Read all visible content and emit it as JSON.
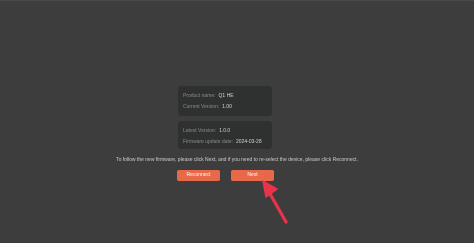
{
  "device": {
    "product_name_label": "Product name:",
    "product_name_value": "Q1 HE",
    "current_version_label": "Current Version:",
    "current_version_value": "1.00"
  },
  "firmware": {
    "latest_version_label": "Latest Version:",
    "latest_version_value": "1.0.0",
    "update_date_label": "Firmware update date:",
    "update_date_value": "2024-03-28"
  },
  "instruction": "To follow the new firmware, please click Next, and if you need to re-select the device, please click Reconnect.",
  "buttons": {
    "reconnect_label": "Reconnect",
    "next_label": "Next"
  },
  "colors": {
    "background": "#3d3d3d",
    "card": "#2f3131",
    "accent": "#e8694a",
    "annotation_arrow": "#e8334a"
  },
  "annotation": {
    "icon": "pointer-arrow-icon"
  }
}
